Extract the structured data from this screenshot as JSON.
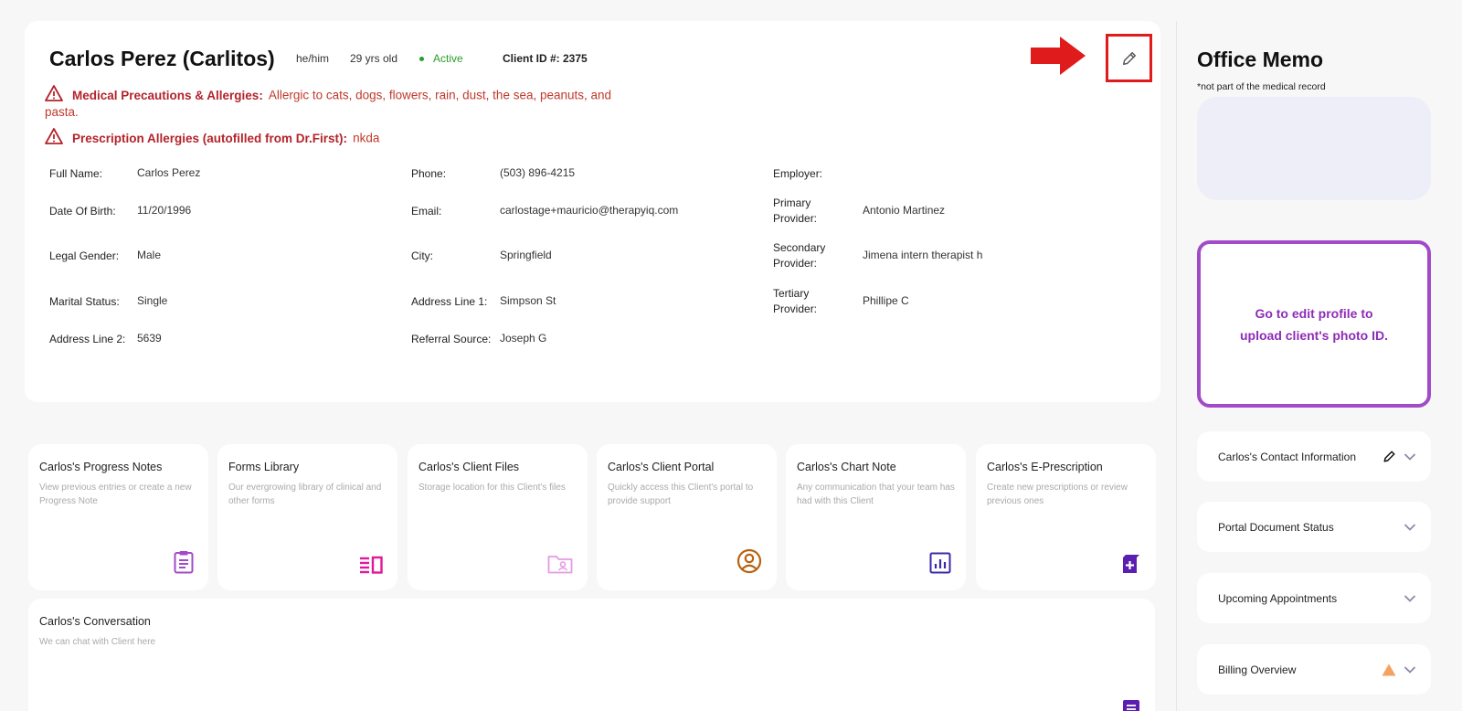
{
  "profile": {
    "name": "Carlos Perez (Carlitos)",
    "pronouns": "he/him",
    "age": "29 yrs old",
    "status": "Active",
    "client_id": "Client ID #: 2375"
  },
  "alerts": {
    "medical_title": "Medical Precautions & Allergies:",
    "medical_text": "Allergic to cats, dogs, flowers, rain, dust, the sea, peanuts, and",
    "medical_text_cont": "pasta.",
    "rx_title": "Prescription Allergies (autofilled from Dr.First):",
    "rx_text": "nkda"
  },
  "fields": {
    "full_name_label": "Full Name:",
    "full_name": "Carlos Perez",
    "dob_label": "Date Of Birth:",
    "dob": "11/20/1996",
    "gender_label": "Legal Gender:",
    "gender": "Male",
    "marital_label": "Marital Status:",
    "marital": "Single",
    "addr2_label": "Address Line 2:",
    "addr2": "5639",
    "phone_label": "Phone:",
    "phone": "(503) 896-4215",
    "email_label": "Email:",
    "email": "carlostage+mauricio@therapyiq.com",
    "city_label": "City:",
    "city": "Springfield",
    "addr1_label": "Address Line 1:",
    "addr1": "Simpson St",
    "referral_label": "Referral Source:",
    "referral": "Joseph G",
    "employer_label": "Employer:",
    "primary_label_1": "Primary",
    "primary_label_2": "Provider:",
    "primary": "Antonio Martinez",
    "secondary_label_1": "Secondary",
    "secondary_label_2": "Provider:",
    "secondary": "Jimena intern therapist h",
    "tertiary_label_1": "Tertiary",
    "tertiary_label_2": "Provider:",
    "tertiary": "Phillipe C"
  },
  "tiles": [
    {
      "title": "Carlos's Progress Notes",
      "desc": "View previous entries or create a new Progress Note",
      "icon": "clipboard-icon",
      "color": "#a24bc9"
    },
    {
      "title": "Forms Library",
      "desc": "Our evergrowing library of clinical and other forms",
      "icon": "forms-icon",
      "color": "#e0199a"
    },
    {
      "title": "Carlos's Client Files",
      "desc": "Storage location for this Client's files",
      "icon": "folder-user-icon",
      "color": "#e59ae5"
    },
    {
      "title": "Carlos's Client Portal",
      "desc": "Quickly access this Client's portal to provide support",
      "icon": "user-circle-icon",
      "color": "#b8620f"
    },
    {
      "title": "Carlos's Chart Note",
      "desc": "Any communication that your team has had with this Client",
      "icon": "chart-icon",
      "color": "#3b2aa8"
    },
    {
      "title": "Carlos's E-Prescription",
      "desc": "Create new prescriptions or review previous ones",
      "icon": "prescription-icon",
      "color": "#5a1eb0"
    }
  ],
  "conversation": {
    "title": "Carlos's Conversation",
    "desc": "We can chat with Client here"
  },
  "sidebar": {
    "memo_title": "Office Memo",
    "memo_note": "*not part of the medical record",
    "photo_line1": "Go to edit profile to",
    "photo_line2": "upload client's photo ID.",
    "accordions": [
      {
        "label": "Carlos's Contact Information"
      },
      {
        "label": "Portal Document Status"
      },
      {
        "label": "Upcoming Appointments"
      },
      {
        "label": "Billing Overview"
      }
    ]
  }
}
